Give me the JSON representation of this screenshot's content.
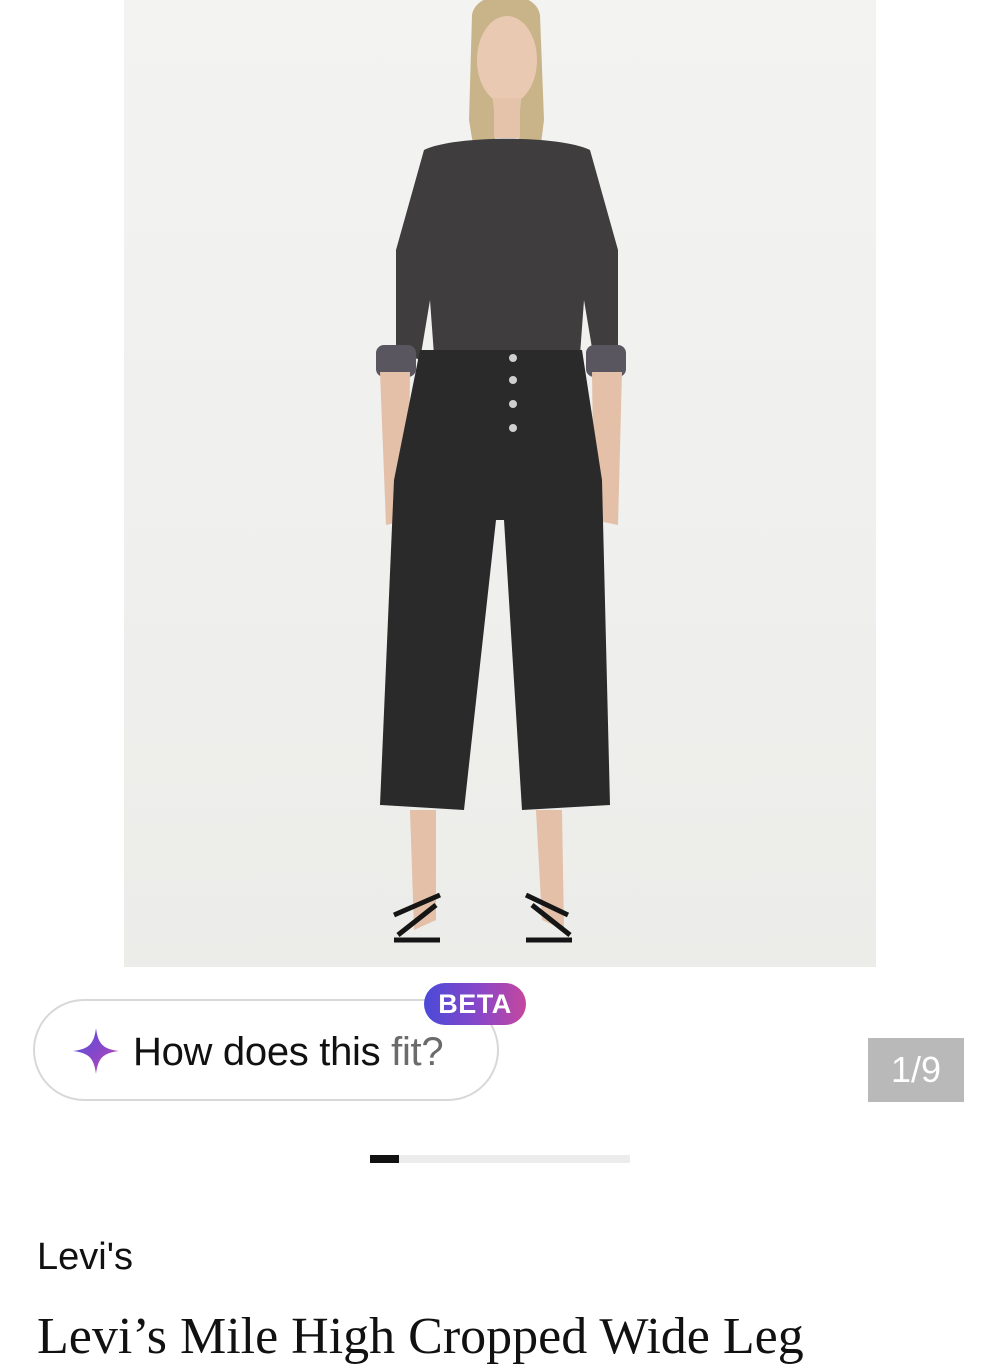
{
  "product_image": {
    "alt": "Levi's Mile High Cropped Wide Leg jeans on model"
  },
  "fit_assistant": {
    "label_main": "How does this ",
    "label_tail": "fit?",
    "badge": "BETA",
    "icon": "sparkle-icon"
  },
  "gallery": {
    "counter": "1/9",
    "progress": 0.111
  },
  "product": {
    "brand": "Levi's",
    "title": "Levi’s Mile High Cropped Wide Leg"
  },
  "colors": {
    "beta_gradient_start": "#4a4ad8",
    "beta_gradient_end": "#c5479e",
    "counter_bg": "#b9b9b9",
    "progress_fill": "#111111"
  }
}
